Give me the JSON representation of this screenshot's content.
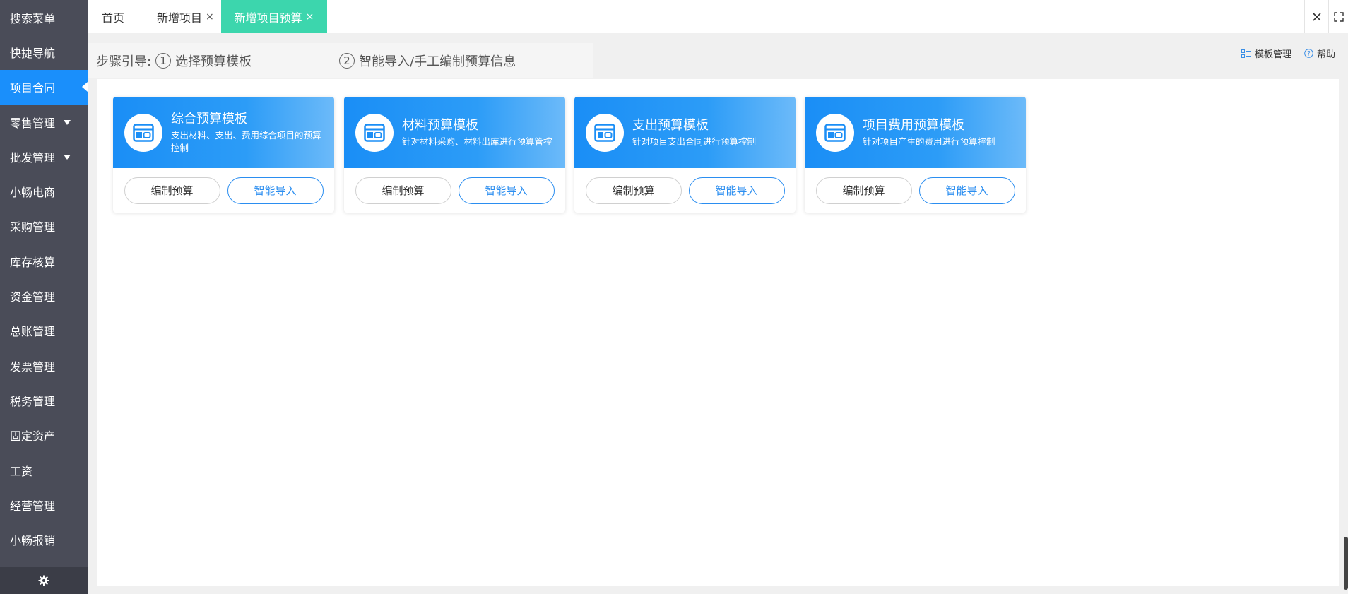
{
  "sidebar": {
    "items": [
      {
        "label": "搜索菜单"
      },
      {
        "label": "快捷导航"
      },
      {
        "label": "项目合同",
        "active": true
      },
      {
        "label": "零售管理",
        "has_caret": true
      },
      {
        "label": "批发管理",
        "has_caret": true
      },
      {
        "label": "小畅电商"
      },
      {
        "label": "采购管理"
      },
      {
        "label": "库存核算"
      },
      {
        "label": "资金管理"
      },
      {
        "label": "总账管理"
      },
      {
        "label": "发票管理"
      },
      {
        "label": "税务管理"
      },
      {
        "label": "固定资产"
      },
      {
        "label": "工资"
      },
      {
        "label": "经营管理"
      },
      {
        "label": "小畅报销"
      }
    ],
    "footer_icon": "gear-icon"
  },
  "tabs": {
    "home": "首页",
    "new_project": "新增项目",
    "new_budget": "新增项目预算",
    "close_glyph": "×"
  },
  "steps": {
    "guide_label": "步骤引导:",
    "step1_num": "1",
    "step1_text": "选择预算模板",
    "step2_num": "2",
    "step2_text": "智能导入/手工编制预算信息"
  },
  "toplinks": {
    "template_manage": "模板管理",
    "help": "帮助"
  },
  "cards": [
    {
      "title": "综合预算模板",
      "desc": "支出材料、支出、费用综合项目的预算控制",
      "edit": "编制预算",
      "import": "智能导入"
    },
    {
      "title": "材料预算模板",
      "desc": "针对材料采购、材料出库进行预算管控",
      "edit": "编制预算",
      "import": "智能导入"
    },
    {
      "title": "支出预算模板",
      "desc": "针对项目支出合同进行预算控制",
      "edit": "编制预算",
      "import": "智能导入"
    },
    {
      "title": "项目费用预算模板",
      "desc": "针对项目产生的费用进行预算控制",
      "edit": "编制预算",
      "import": "智能导入"
    }
  ],
  "colors": {
    "sidebar_bg": "#4a4c58",
    "sidebar_active": "#1a8ffb",
    "tab_active": "#3cd6ad",
    "card_header": "#1a8ef6",
    "button_accent": "#2b8ef0"
  }
}
